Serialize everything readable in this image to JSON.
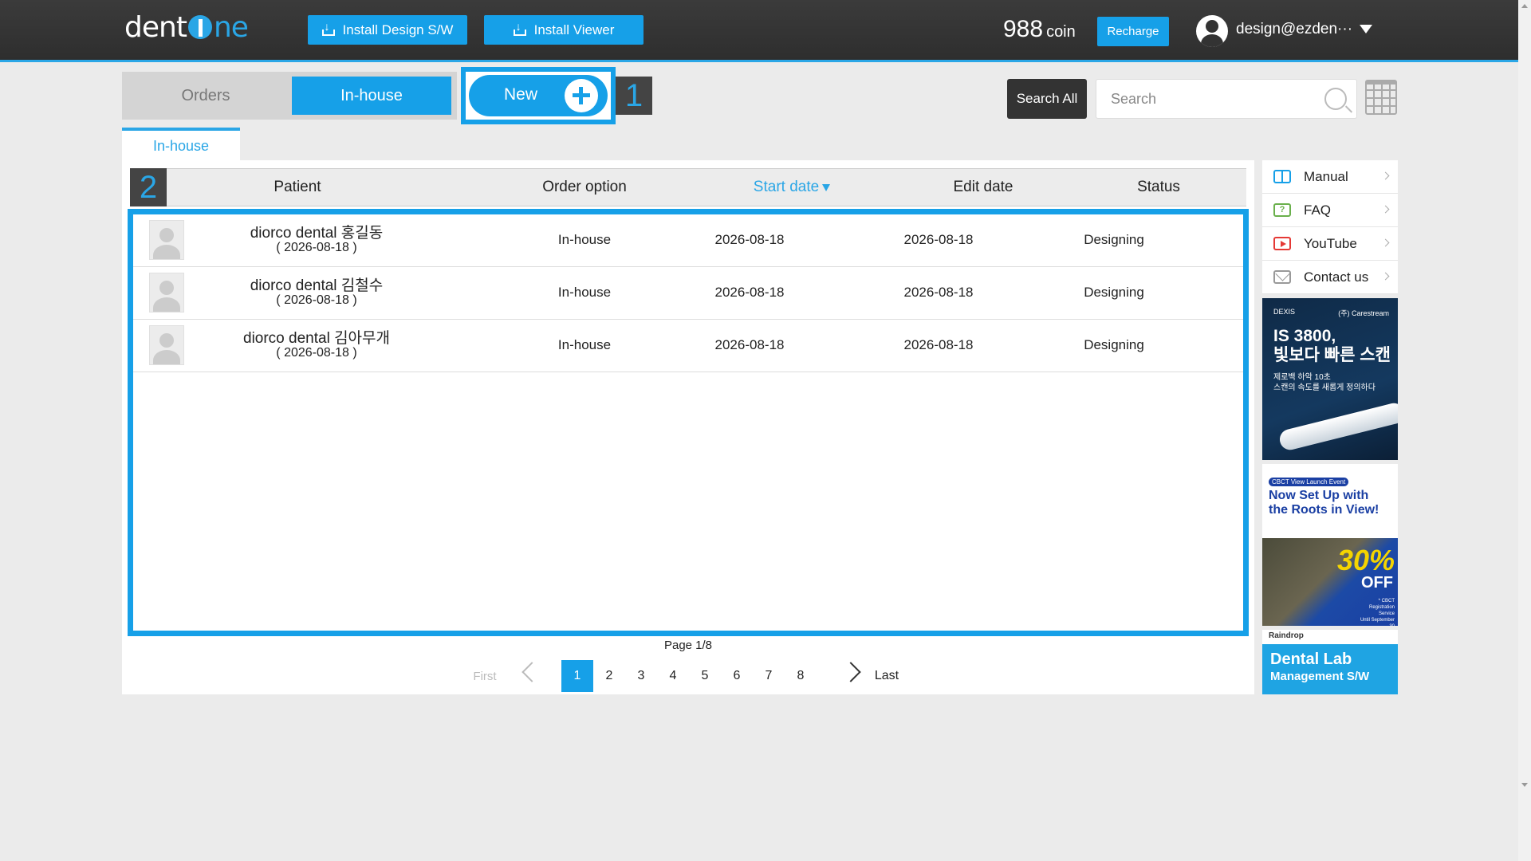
{
  "header": {
    "logo": {
      "pre": "dent",
      "post": "ne"
    },
    "install_design_label": "Install Design S/W",
    "install_viewer_label": "Install Viewer",
    "coin_value": "988",
    "coin_unit": "coin",
    "recharge_label": "Recharge",
    "user_email": "design@ezden···"
  },
  "tabs": {
    "orders_label": "Orders",
    "inhouse_label": "In-house",
    "new_label": "New",
    "marker1": "1",
    "marker2": "2"
  },
  "search": {
    "search_all_label": "Search All",
    "placeholder": "Search"
  },
  "subtab_label": "In-house",
  "table": {
    "columns": [
      "Patient",
      "Order option",
      "Start date",
      "Edit date",
      "Status"
    ],
    "rows": [
      {
        "patient": "diorco dental 홍길동",
        "patient_date": "( 2026-08-18 )",
        "option": "In-house",
        "start": "2026-08-18",
        "edit": "2026-08-18",
        "status": "Designing"
      },
      {
        "patient": "diorco dental 김철수",
        "patient_date": "( 2026-08-18 )",
        "option": "In-house",
        "start": "2026-08-18",
        "edit": "2026-08-18",
        "status": "Designing"
      },
      {
        "patient": "diorco dental 김아무개",
        "patient_date": "( 2026-08-18 )",
        "option": "In-house",
        "start": "2026-08-18",
        "edit": "2026-08-18",
        "status": "Designing"
      }
    ]
  },
  "pagination": {
    "info": "Page 1/8",
    "first": "First",
    "last": "Last",
    "pages": [
      "1",
      "2",
      "3",
      "4",
      "5",
      "6",
      "7",
      "8"
    ],
    "current": "1"
  },
  "side_menu": [
    "Manual",
    "FAQ",
    "YouTube",
    "Contact us"
  ],
  "ads": {
    "ad1": {
      "brand_left": "DEXIS",
      "brand_right": "(주) Carestream",
      "headline1": "IS 3800,",
      "headline2": "빛보다 빠른 스캔",
      "sub1": "제로백 하악 10초",
      "sub2": "스캔의 속도를 새롭게 정의하다"
    },
    "ad2": {
      "tag": "CBCT View Launch Event",
      "title1": "Now Set Up with",
      "title2": "the Roots in View!",
      "pct": "30%",
      "off": "OFF",
      "fine1": "* CBCT Registration Service",
      "fine2": "Until September 30"
    },
    "ad3": {
      "brand": "Raindrop",
      "title": "Dental Lab",
      "subtitle": "Management S/W"
    }
  },
  "accent_color": "#16a0e8"
}
